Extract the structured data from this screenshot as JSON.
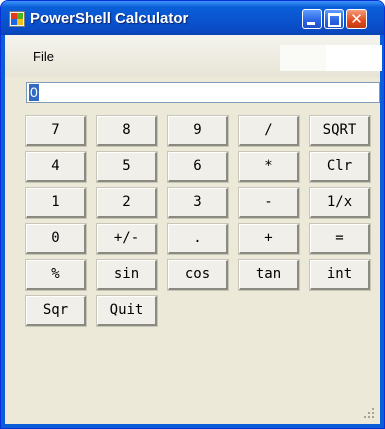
{
  "window": {
    "title": "PowerShell Calculator"
  },
  "menu": {
    "file": "File"
  },
  "display": {
    "value": "0"
  },
  "keys": [
    [
      "7",
      "8",
      "9",
      "/",
      "SQRT"
    ],
    [
      "4",
      "5",
      "6",
      "*",
      "Clr"
    ],
    [
      "1",
      "2",
      "3",
      "-",
      "1/x"
    ],
    [
      "0",
      "+/-",
      ".",
      "+",
      "="
    ],
    [
      "%",
      "sin",
      "cos",
      "tan",
      "int"
    ],
    [
      "Sqr",
      "Quit"
    ]
  ],
  "colors": {
    "titlebar": "#0a5fd8",
    "client": "#ece9d8",
    "close": "#e24a1e"
  },
  "icons": {
    "app": "app-icon",
    "minimize": "minimize-icon",
    "maximize": "maximize-icon",
    "close": "close-icon"
  }
}
